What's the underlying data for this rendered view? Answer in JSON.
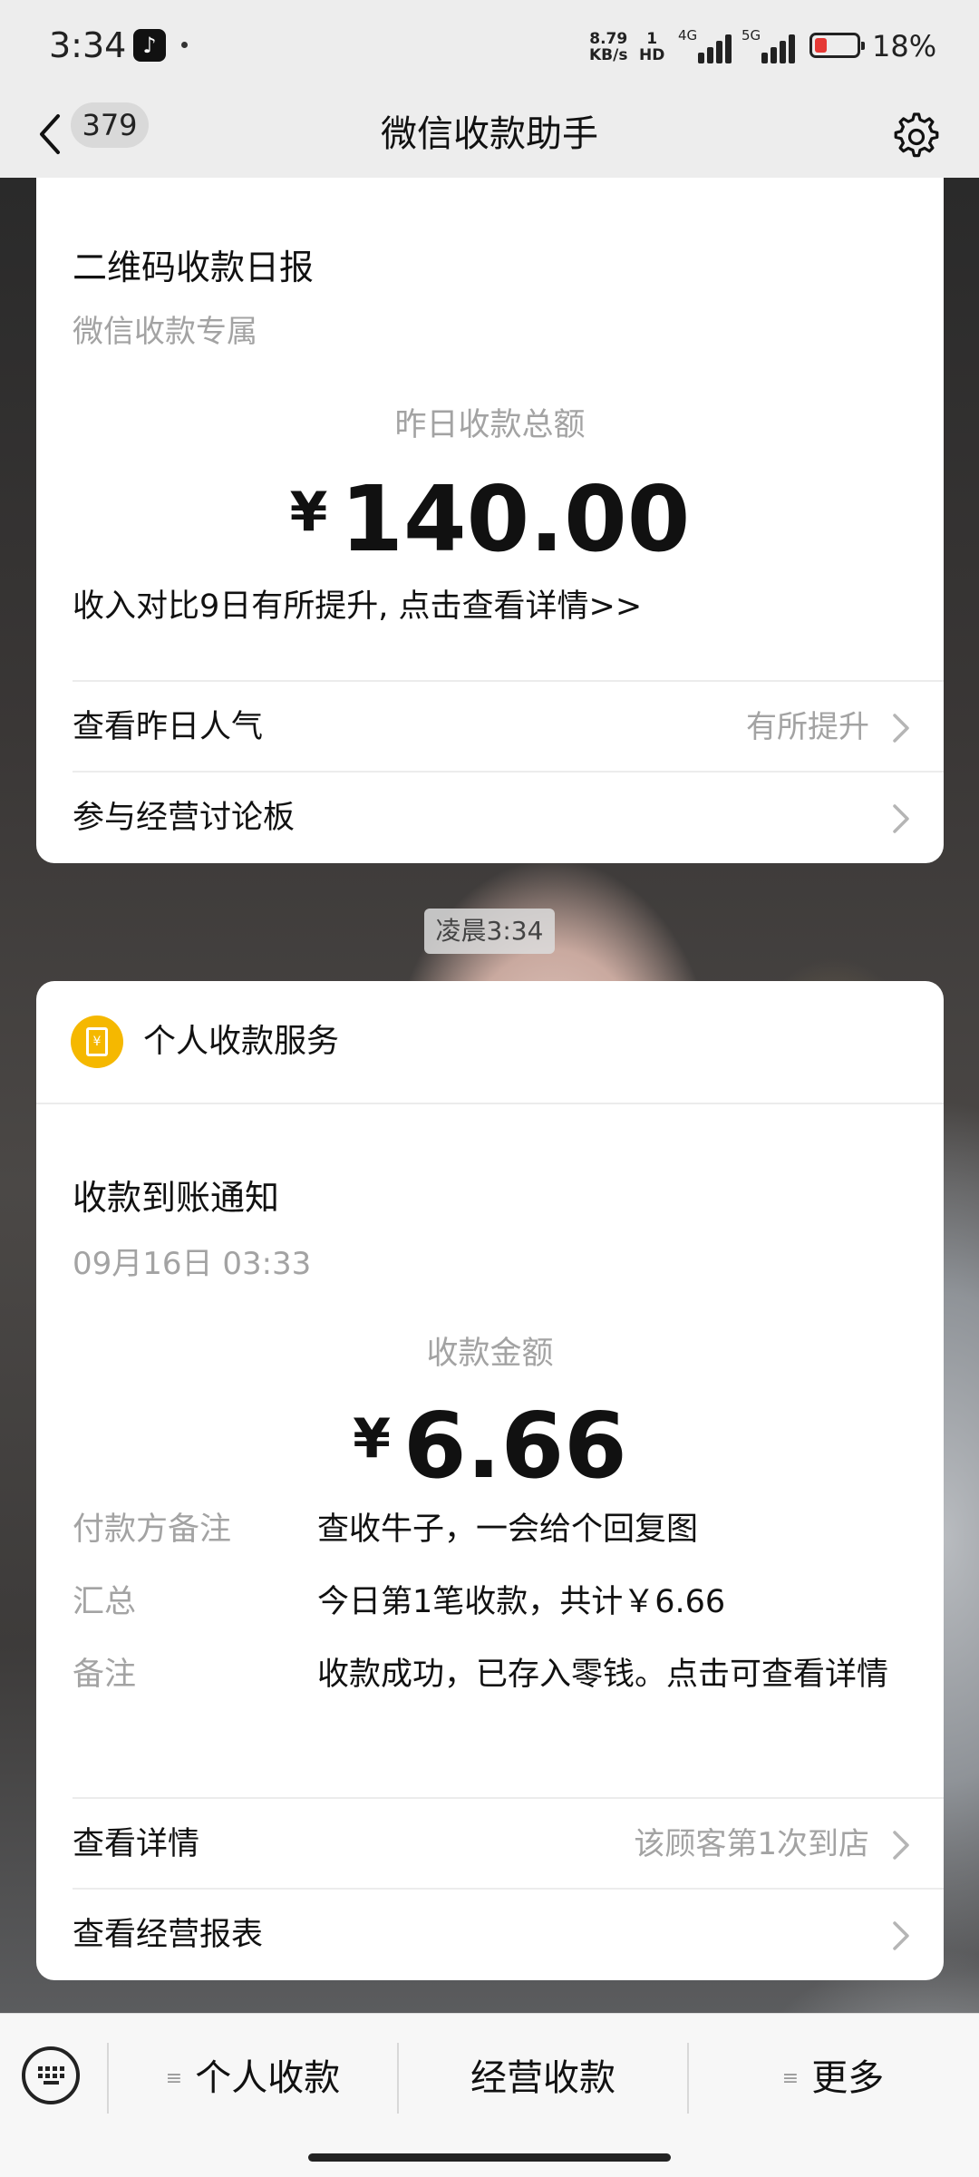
{
  "status_bar": {
    "time": "3:34",
    "app_icon": "tiktok-icon",
    "net_speed_value": "8.79",
    "net_speed_unit": "KB/s",
    "volte_top": "1",
    "volte_bottom": "HD",
    "signal1_tag": "4G",
    "signal2_tag": "5G",
    "battery_level_percent": 18,
    "battery_color": "#e53935",
    "battery_text": "18%"
  },
  "nav": {
    "back_icon": "chevron-left-icon",
    "unread_count": "379",
    "title": "微信收款助手",
    "settings_icon": "gear-icon"
  },
  "daily_report": {
    "title": "二维码收款日报",
    "subtitle": "微信收款专属",
    "total_label": "昨日收款总额",
    "currency": "¥",
    "total_amount": "140.00",
    "compare_text": "收入对比9日有所提升, 点击查看详情>>",
    "rows": [
      {
        "label": "查看昨日人气",
        "value": "有所提升"
      },
      {
        "label": "参与经营讨论板",
        "value": ""
      }
    ]
  },
  "timestamp": "凌晨3:34",
  "payment_notice": {
    "service_icon": "wallet-icon",
    "service_icon_color": "#f5b800",
    "service_name": "个人收款服务",
    "title": "收款到账通知",
    "datetime": "09月16日 03:33",
    "amount_label": "收款金额",
    "currency": "¥",
    "amount": "6.66",
    "details": [
      {
        "key": "付款方备注",
        "value": "查收牛子，一会给个回复图"
      },
      {
        "key": "汇总",
        "value": "今日第1笔收款，共计￥6.66"
      },
      {
        "key": "备注",
        "value": "收款成功，已存入零钱。点击可查看详情"
      }
    ],
    "rows": [
      {
        "label": "查看详情",
        "value": "该顾客第1次到店"
      },
      {
        "label": "查看经营报表",
        "value": ""
      }
    ]
  },
  "bottom_menu": {
    "keyboard_icon": "keyboard-icon",
    "items": [
      {
        "label": "个人收款",
        "has_submenu": true
      },
      {
        "label": "经营收款",
        "has_submenu": false
      },
      {
        "label": "更多",
        "has_submenu": true
      }
    ]
  }
}
